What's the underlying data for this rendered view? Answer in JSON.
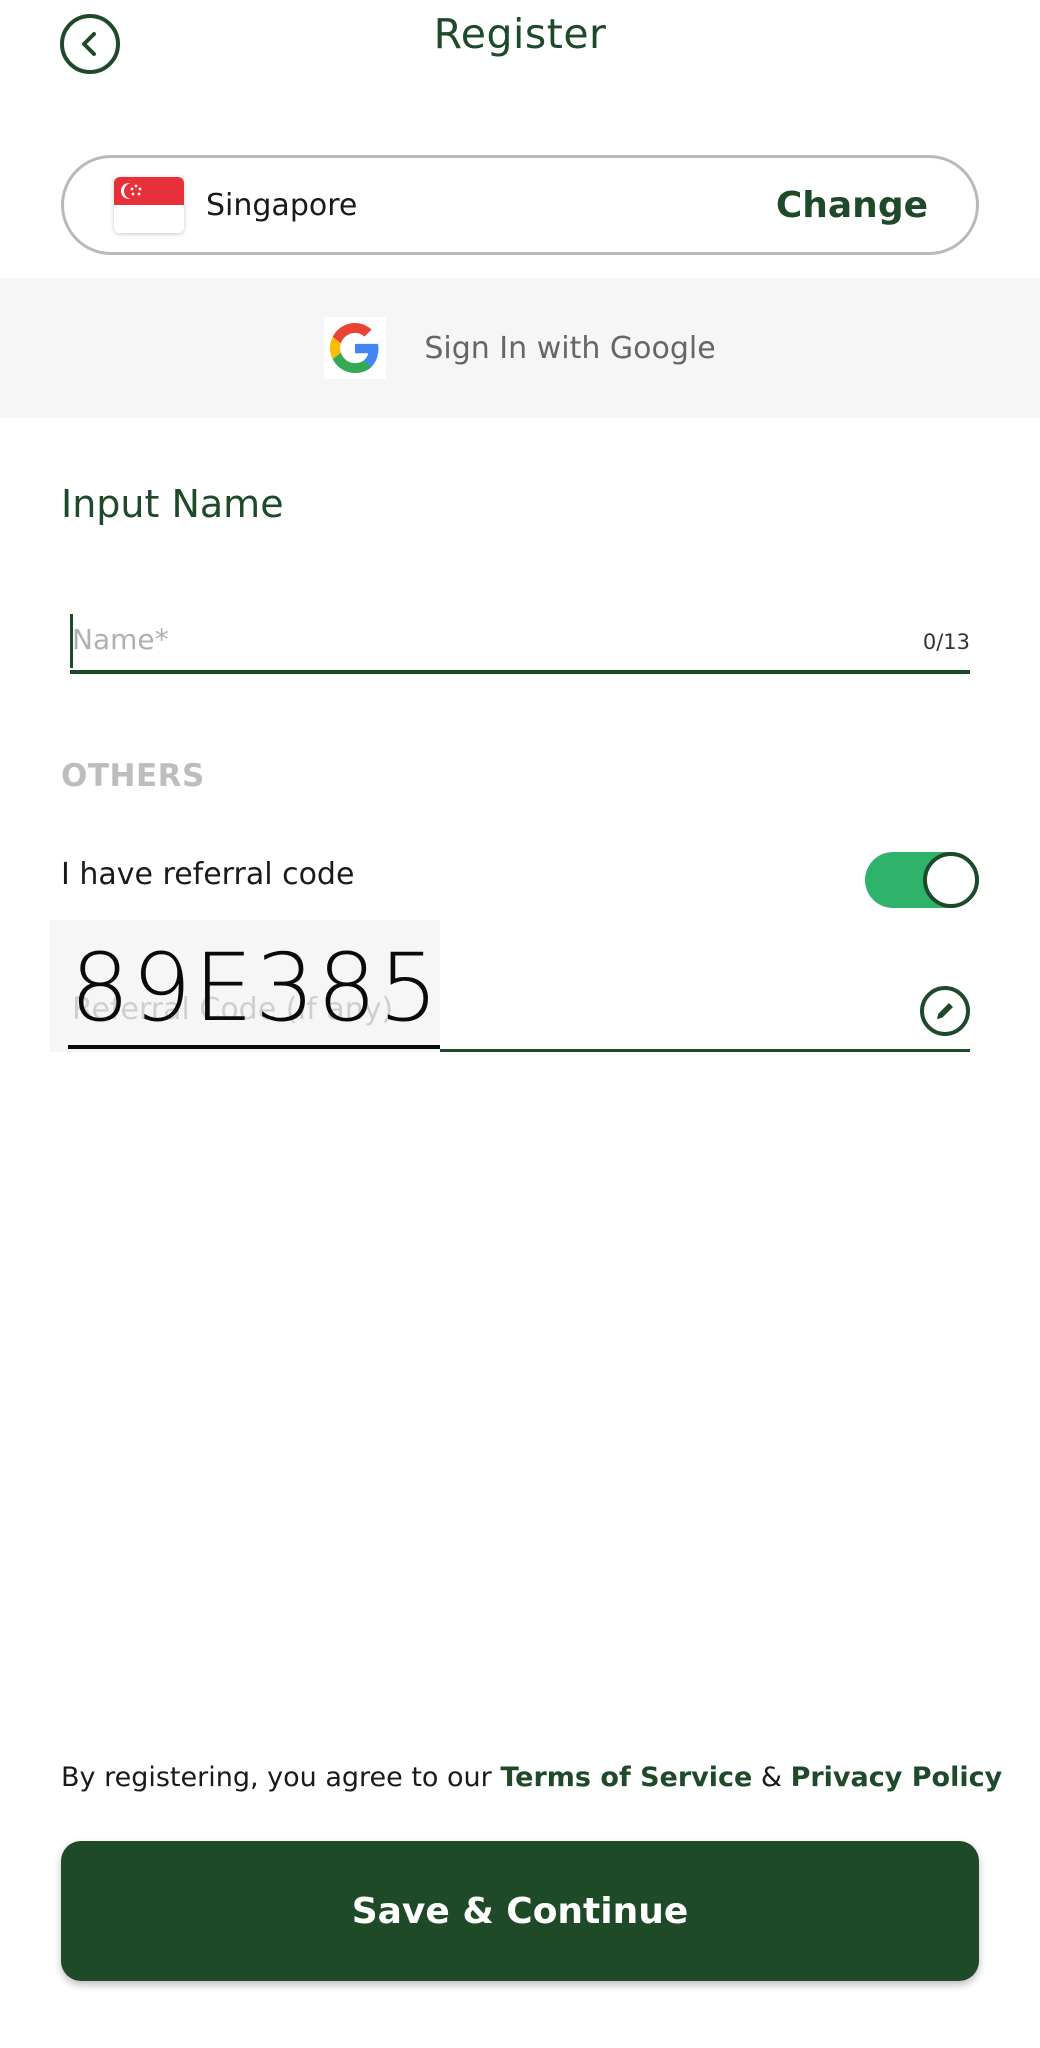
{
  "header": {
    "title": "Register",
    "back_icon": "chevron-left-icon"
  },
  "country": {
    "name": "Singapore",
    "change_label": "Change",
    "flag_icon": "singapore-flag-icon"
  },
  "google": {
    "label": "Sign In with Google",
    "icon": "google-logo-icon"
  },
  "name_section": {
    "title": "Input Name",
    "placeholder": "Name*",
    "value": "",
    "counter": "0/13"
  },
  "others": {
    "title": "OTHERS",
    "referral_label": "I have referral code",
    "referral_toggle_on": true,
    "referral_placeholder": "Referral Code (If any)",
    "referral_value": "89E385",
    "edit_icon": "pencil-icon"
  },
  "footer": {
    "terms_prefix": "By registering, you agree to our ",
    "terms_link": "Terms of Service",
    "terms_and": " & ",
    "privacy_link": "Privacy Policy",
    "save_label": "Save & Continue"
  },
  "colors": {
    "primary": "#1e4a2a",
    "toggle_on": "#2fb36b",
    "button": "#1f4a27",
    "band": "#f6f6f6"
  }
}
